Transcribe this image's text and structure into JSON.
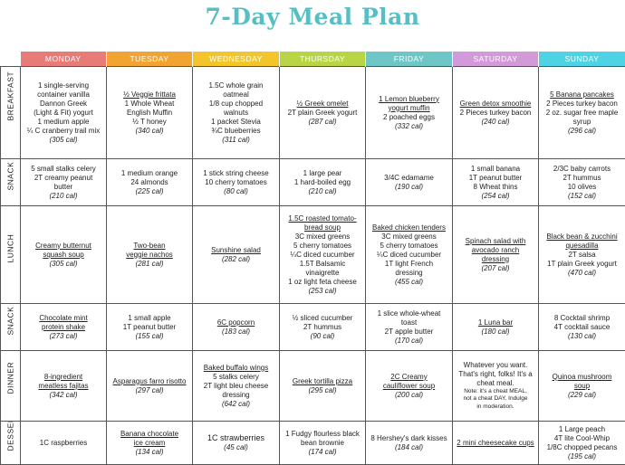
{
  "title": "7-Day Meal Plan",
  "days": [
    {
      "label": "MONDAY",
      "color": "#e87a78"
    },
    {
      "label": "TUESDAY",
      "color": "#f1a431"
    },
    {
      "label": "WEDNESDAY",
      "color": "#f2c62a"
    },
    {
      "label": "THURSDAY",
      "color": "#b9d546"
    },
    {
      "label": "FRIDAY",
      "color": "#6ec6c6"
    },
    {
      "label": "SATURDAY",
      "color": "#d29ad9"
    },
    {
      "label": "SUNDAY",
      "color": "#4ed3e5"
    }
  ],
  "meals": [
    {
      "label": "BREAKFAST",
      "cells": [
        {
          "lines": [
            {
              "t": "1 single-serving"
            },
            {
              "t": "container vanilla"
            },
            {
              "t": "Dannon Greek"
            },
            {
              "t": "(Light & Fit) yogurt"
            },
            {
              "t": "1 medium apple"
            },
            {
              "t": "¼ C cranberry trail mix"
            },
            {
              "t": "(305 cal)",
              "c": "cal"
            }
          ]
        },
        {
          "lines": [
            {
              "t": "½ Veggie frittata",
              "c": "ul"
            },
            {
              "t": "1 Whole Wheat"
            },
            {
              "t": "English Muffin"
            },
            {
              "t": "½ T honey"
            },
            {
              "t": "(340 cal)",
              "c": "cal"
            }
          ]
        },
        {
          "lines": [
            {
              "t": "1.5C whole grain"
            },
            {
              "t": "oatmeal"
            },
            {
              "t": "1/8 cup chopped"
            },
            {
              "t": "walnuts"
            },
            {
              "t": "1 packet Stevia"
            },
            {
              "t": "¾C blueberries"
            },
            {
              "t": "(311 cal)",
              "c": "cal"
            }
          ]
        },
        {
          "lines": [
            {
              "t": "½ Greek omelet",
              "c": "ul"
            },
            {
              "t": "2T plain Greek yogurt"
            },
            {
              "t": "(287 cal)",
              "c": "cal"
            }
          ]
        },
        {
          "lines": [
            {
              "t": "1 Lemon blueberry",
              "c": "ul"
            },
            {
              "t": "yogurt muffin",
              "c": "ul"
            },
            {
              "t": "2 poached eggs"
            },
            {
              "t": "(332 cal)",
              "c": "cal"
            }
          ]
        },
        {
          "lines": [
            {
              "t": "Green detox smoothie",
              "c": "ul"
            },
            {
              "t": "2 Pieces turkey bacon"
            },
            {
              "t": "(240 cal)",
              "c": "cal"
            }
          ]
        },
        {
          "lines": [
            {
              "t": "5 Banana pancakes",
              "c": "ul"
            },
            {
              "t": "2 Pieces turkey bacon"
            },
            {
              "t": "2 oz. sugar free maple"
            },
            {
              "t": "syrup"
            },
            {
              "t": "(296 cal)",
              "c": "cal"
            }
          ]
        }
      ]
    },
    {
      "label": "SNACK",
      "cells": [
        {
          "lines": [
            {
              "t": "5 small stalks celery"
            },
            {
              "t": "2T creamy peanut"
            },
            {
              "t": "butter"
            },
            {
              "t": "(210 cal)",
              "c": "cal"
            }
          ]
        },
        {
          "lines": [
            {
              "t": "1 medium orange"
            },
            {
              "t": "24 almonds"
            },
            {
              "t": "(225 cal)",
              "c": "cal"
            }
          ]
        },
        {
          "lines": [
            {
              "t": "1 stick string cheese"
            },
            {
              "t": "10 cherry tomatoes"
            },
            {
              "t": "(80 cal)",
              "c": "cal"
            }
          ]
        },
        {
          "lines": [
            {
              "t": "1 large pear"
            },
            {
              "t": "1 hard-boiled egg"
            },
            {
              "t": "(210 cal)",
              "c": "cal"
            }
          ]
        },
        {
          "lines": [
            {
              "t": "3/4C edamame"
            },
            {
              "t": "(190 cal)",
              "c": "cal"
            }
          ]
        },
        {
          "lines": [
            {
              "t": "1 small banana"
            },
            {
              "t": "1T peanut butter"
            },
            {
              "t": "8 Wheat thins"
            },
            {
              "t": "(254 cal)",
              "c": "cal"
            }
          ]
        },
        {
          "lines": [
            {
              "t": "2/3C baby carrots"
            },
            {
              "t": "2T hummus"
            },
            {
              "t": "10 olives"
            },
            {
              "t": "(152 cal)",
              "c": "cal"
            }
          ]
        }
      ]
    },
    {
      "label": "LUNCH",
      "cells": [
        {
          "lines": [
            {
              "t": "Creamy butternut",
              "c": "ul"
            },
            {
              "t": "squash soup",
              "c": "ul"
            },
            {
              "t": "(305 cal)",
              "c": "cal"
            }
          ]
        },
        {
          "lines": [
            {
              "t": "Two-bean",
              "c": "ul"
            },
            {
              "t": "veggie nachos",
              "c": "ul"
            },
            {
              "t": "(281 cal)",
              "c": "cal"
            }
          ]
        },
        {
          "lines": [
            {
              "t": "Sunshine salad",
              "c": "ul"
            },
            {
              "t": "(282 cal)",
              "c": "cal"
            }
          ]
        },
        {
          "lines": [
            {
              "t": "1.5C roasted tomato-",
              "c": "ul"
            },
            {
              "t": "bread soup",
              "c": "ul"
            },
            {
              "t": "3C mixed greens"
            },
            {
              "t": "5 cherry tomatoes"
            },
            {
              "t": "¼C diced cucumber"
            },
            {
              "t": "1.5T Balsamic"
            },
            {
              "t": "vinaigrette"
            },
            {
              "t": "1 oz light feta cheese"
            },
            {
              "t": "(253 cal)",
              "c": "cal"
            }
          ]
        },
        {
          "lines": [
            {
              "t": "Baked chicken tenders",
              "c": "ul"
            },
            {
              "t": "3C mixed greens"
            },
            {
              "t": "5 cherry tomatoes"
            },
            {
              "t": "¼C diced cucumber"
            },
            {
              "t": "1T light French"
            },
            {
              "t": "dressing"
            },
            {
              "t": "(455 cal)",
              "c": "cal"
            }
          ]
        },
        {
          "lines": [
            {
              "t": "Spinach salad with",
              "c": "ul"
            },
            {
              "t": "avocado ranch",
              "c": "ul"
            },
            {
              "t": "dressing",
              "c": "ul"
            },
            {
              "t": "(207 cal)",
              "c": "cal"
            }
          ]
        },
        {
          "lines": [
            {
              "t": "Black bean & zucchini",
              "c": "ul"
            },
            {
              "t": "quesadilla",
              "c": "ul"
            },
            {
              "t": "2T salsa"
            },
            {
              "t": "1T plain Greek yogurt"
            },
            {
              "t": "(470 cal)",
              "c": "cal"
            }
          ]
        }
      ]
    },
    {
      "label": "SNACK",
      "cells": [
        {
          "lines": [
            {
              "t": "Chocolate mint",
              "c": "ul"
            },
            {
              "t": "protein shake",
              "c": "ul"
            },
            {
              "t": "(273 cal)",
              "c": "cal"
            }
          ]
        },
        {
          "lines": [
            {
              "t": "1 small apple"
            },
            {
              "t": "1T peanut butter"
            },
            {
              "t": "(155 cal)",
              "c": "cal"
            }
          ]
        },
        {
          "lines": [
            {
              "t": "6C popcorn",
              "c": "ul"
            },
            {
              "t": "(183 cal)",
              "c": "cal"
            }
          ]
        },
        {
          "lines": [
            {
              "t": "½ sliced cucumber"
            },
            {
              "t": "2T hummus"
            },
            {
              "t": "(90 cal)",
              "c": "cal"
            }
          ]
        },
        {
          "lines": [
            {
              "t": "1 slice whole-wheat"
            },
            {
              "t": "toast"
            },
            {
              "t": "2T apple butter"
            },
            {
              "t": "(170 cal)",
              "c": "cal"
            }
          ]
        },
        {
          "lines": [
            {
              "t": "1 Luna bar",
              "c": "ul"
            },
            {
              "t": "(180 cal)",
              "c": "cal"
            }
          ]
        },
        {
          "lines": [
            {
              "t": "8 Cocktail shrimp"
            },
            {
              "t": "4T cocktail sauce"
            },
            {
              "t": "(130 cal)",
              "c": "cal"
            }
          ]
        }
      ]
    },
    {
      "label": "DINNER",
      "cells": [
        {
          "lines": [
            {
              "t": "8-ingredient",
              "c": "ul"
            },
            {
              "t": "meatless fajitas",
              "c": "ul"
            },
            {
              "t": "(342 cal)",
              "c": "cal"
            }
          ]
        },
        {
          "lines": [
            {
              "t": "Asparagus farro risotto",
              "c": "ul"
            },
            {
              "t": "(297 cal)",
              "c": "cal"
            }
          ]
        },
        {
          "lines": [
            {
              "t": "Baked buffalo wings",
              "c": "ul"
            },
            {
              "t": "5 stalks celery"
            },
            {
              "t": "2T light bleu cheese"
            },
            {
              "t": "dressing"
            },
            {
              "t": "(642 cal)",
              "c": "cal"
            }
          ]
        },
        {
          "lines": [
            {
              "t": "Greek tortilla pizza",
              "c": "ul"
            },
            {
              "t": "(295 cal)",
              "c": "cal"
            }
          ]
        },
        {
          "lines": [
            {
              "t": "2C Creamy",
              "c": "ul"
            },
            {
              "t": "cauliflower soup",
              "c": "ul"
            },
            {
              "t": "(200 cal)",
              "c": "cal"
            }
          ]
        },
        {
          "lines": [
            {
              "t": "Whatever you want."
            },
            {
              "t": "That's right, folks! It's a"
            },
            {
              "t": "cheat meal."
            },
            {
              "t": "Note: it's a cheat MEAL,",
              "c": "small"
            },
            {
              "t": "not a cheat DAY. Indulge",
              "c": "small"
            },
            {
              "t": "in moderation.",
              "c": "small"
            }
          ]
        },
        {
          "lines": [
            {
              "t": "Quinoa mushroom",
              "c": "ul"
            },
            {
              "t": "soup",
              "c": "ul"
            },
            {
              "t": "(229 cal)",
              "c": "cal"
            }
          ]
        }
      ]
    },
    {
      "label": "DESSERT",
      "cells": [
        {
          "lines": [
            {
              "t": "1C raspberries"
            }
          ]
        },
        {
          "lines": [
            {
              "t": "Banana chocolate",
              "c": "ul"
            },
            {
              "t": "ice cream",
              "c": "ul"
            },
            {
              "t": "(134 cal)",
              "c": "cal"
            }
          ]
        },
        {
          "lines": [
            {
              "t": "1C strawberries",
              "c": "big"
            },
            {
              "t": "(45 cal)",
              "c": "cal"
            }
          ]
        },
        {
          "lines": [
            {
              "t": "1 Fudgy flourless black"
            },
            {
              "t": "bean brownie"
            },
            {
              "t": "(174 cal)",
              "c": "cal"
            }
          ]
        },
        {
          "lines": [
            {
              "t": "8 Hershey's dark kisses"
            },
            {
              "t": "(184 cal)",
              "c": "cal"
            }
          ]
        },
        {
          "lines": [
            {
              "t": "2 mini cheesecake cups",
              "c": "ul"
            }
          ]
        },
        {
          "lines": [
            {
              "t": "1 Large peach"
            },
            {
              "t": "4T lite Cool-Whip"
            },
            {
              "t": "1/8C chopped pecans"
            },
            {
              "t": "(195 cal)",
              "c": "cal"
            }
          ]
        }
      ]
    }
  ]
}
